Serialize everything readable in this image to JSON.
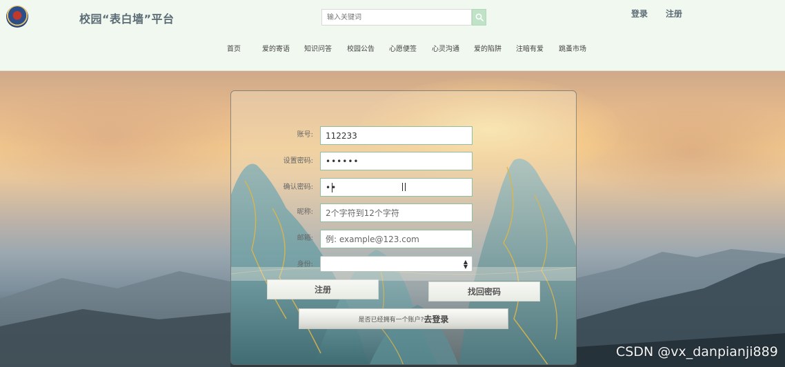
{
  "header": {
    "site_title": "校园“表白墙”平台",
    "search": {
      "placeholder": "输入关键词",
      "button_icon": "search-icon"
    },
    "login_label": "登录",
    "register_label": "注册"
  },
  "nav": {
    "items": [
      {
        "label": "首页"
      },
      {
        "label": "爱的寄语"
      },
      {
        "label": "知识问答"
      },
      {
        "label": "校园公告"
      },
      {
        "label": "心愿便签"
      },
      {
        "label": "心灵沟通"
      },
      {
        "label": "爱的陷阱"
      },
      {
        "label": "注暗有爱"
      },
      {
        "label": "跳蚤市场"
      }
    ]
  },
  "form": {
    "account": {
      "label": "账号:",
      "value": "112233"
    },
    "password": {
      "label": "设置密码:",
      "value": "••••••"
    },
    "confirm_password": {
      "label": "确认密码:",
      "value": "••"
    },
    "nickname": {
      "label": "昵称:",
      "placeholder": "2个字符到12个字符"
    },
    "email": {
      "label": "邮箱:",
      "placeholder": "例: example@123.com"
    },
    "identity": {
      "label": "身份:",
      "selected": ""
    },
    "register_button": "注册",
    "recover_button": "找回密码",
    "login_prompt": {
      "question": "是否已经拥有一个账户?",
      "action": "去登录"
    }
  },
  "watermark": "CSDN @vx_danpianji889",
  "colors": {
    "header_bg": "#f1f8ef",
    "search_button": "#bfe3c6",
    "input_border": "#8fbfa0",
    "title_text": "#5b6b75"
  }
}
